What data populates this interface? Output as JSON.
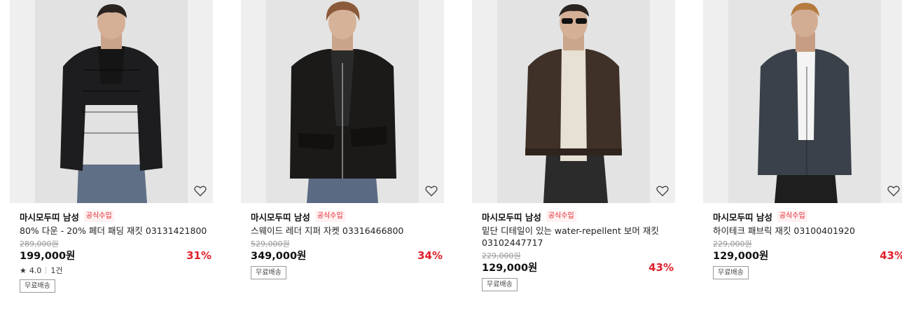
{
  "products": [
    {
      "brand": "마시모두띠 남성",
      "badge": "공식수입",
      "name": "80% 다운 - 20% 페더 패딩 재킷 03131421800",
      "original_price": "289,000원",
      "price": "199,000원",
      "discount": "31%",
      "rating": "4.0",
      "reviews": "1건",
      "shipping": "무료배송",
      "jacket_color": "#1d1d1f",
      "inner_color": "#151515",
      "pants_color": "#5f6f86"
    },
    {
      "brand": "마시모두띠 남성",
      "badge": "공식수입",
      "name": "스웨이드 레더 지퍼 자켓 03316466800",
      "original_price": "529,000원",
      "price": "349,000원",
      "discount": "34%",
      "shipping": "무료배송",
      "jacket_color": "#1b1a18",
      "inner_color": "#2a2a2a",
      "pants_color": "#5a6a82"
    },
    {
      "brand": "마시모두띠 남성",
      "badge": "공식수입",
      "name": "밑단 디테일이 있는 water-repellent 보머 재킷 03102447717",
      "original_price": "229,000원",
      "price": "129,000원",
      "discount": "43%",
      "shipping": "무료배송",
      "jacket_color": "#3f3128",
      "inner_color": "#e7e0d4",
      "pants_color": "#2b2b2b"
    },
    {
      "brand": "마시모두띠 남성",
      "badge": "공식수입",
      "name": "하이테크 패브릭 재킷 03100401920",
      "original_price": "229,000원",
      "price": "129,000원",
      "discount": "43%",
      "shipping": "무료배송",
      "jacket_color": "#3a414a",
      "inner_color": "#f4f4f4",
      "pants_color": "#1e1e1e"
    }
  ],
  "icons": {
    "wishlist": "heart-outline-icon",
    "rating": "star-icon"
  },
  "colors": {
    "discount": "#e0202a",
    "badge": "#e0202a"
  }
}
